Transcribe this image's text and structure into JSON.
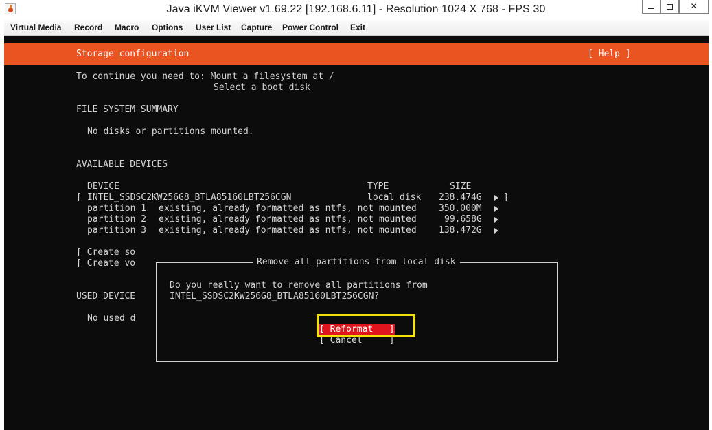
{
  "window": {
    "title": "Java iKVM Viewer v1.69.22 [192.168.6.11]  - Resolution 1024 X 768 - FPS 30",
    "close_glyph": "✕"
  },
  "menu": [
    "Virtual Media",
    "Record",
    "Macro",
    "Options",
    "User List",
    "Capture",
    "Power Control",
    "Exit"
  ],
  "screen": {
    "header_title": "Storage configuration",
    "help_label": "[ Help ]",
    "continue_line1": "To continue you need to: Mount a filesystem at /",
    "continue_line2": "Select a boot disk",
    "fs_summary_heading": "FILE SYSTEM SUMMARY",
    "fs_summary_text": "No disks or partitions mounted.",
    "available_heading": "AVAILABLE DEVICES",
    "columns": {
      "device": "DEVICE",
      "type": "TYPE",
      "size": "SIZE"
    },
    "disk": {
      "bracket_open": "[",
      "name": "INTEL_SSDSC2KW256G8_BTLA85160LBT256CGN",
      "type": "local disk",
      "size": "238.474G",
      "bracket_close": "]"
    },
    "partitions": [
      {
        "name": "partition 1",
        "desc": "existing, already formatted as ntfs, not mounted",
        "size": "350.000M"
      },
      {
        "name": "partition 2",
        "desc": "existing, already formatted as ntfs, not mounted",
        "size": "99.658G"
      },
      {
        "name": "partition 3",
        "desc": "existing, already formatted as ntfs, not mounted",
        "size": "138.472G"
      }
    ],
    "create_1": "[ Create so",
    "create_2": "[ Create vo",
    "used_heading": "USED DEVICE",
    "no_used": "No used d"
  },
  "dialog": {
    "title": "Remove all partitions from local disk",
    "question_line1": "Do you really want to remove all partitions from",
    "question_line2": "INTEL_SSDSC2KW256G8_BTLA85160LBT256CGN?",
    "reformat_label": "[ Reformat   ]",
    "cancel_label": "[ Cancel     ]"
  },
  "colors": {
    "accent": "#e95420",
    "focus_button": "#e0141c",
    "highlight_box": "#f4e30b",
    "console_bg": "#0c0c0c"
  }
}
